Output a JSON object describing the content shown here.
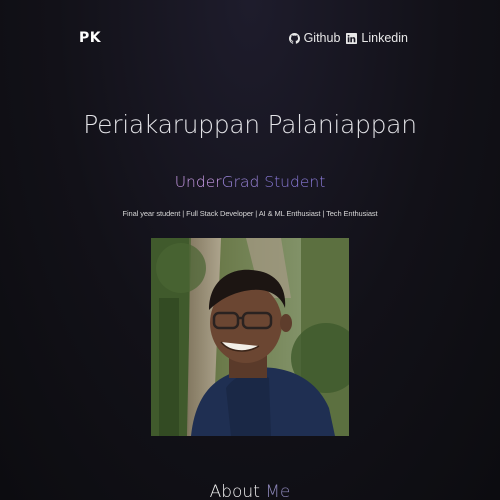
{
  "nav": {
    "logo": "PK",
    "links": [
      {
        "label": "Github",
        "icon": "github-icon"
      },
      {
        "label": "Linkedin",
        "icon": "linkedin-icon"
      }
    ]
  },
  "hero": {
    "name": "Periakaruppan Palaniappan",
    "role_parts": [
      "Under",
      "Grad",
      " Student"
    ],
    "tagline": "Final year student | Full Stack Developer | AI & ML Enthusiast | Tech Enthusiast",
    "photo_label": "profile-photo"
  },
  "about": {
    "heading_first": "About",
    "heading_second": "Me"
  },
  "colors": {
    "background": "#121118",
    "gradient_pink": "#c89ae6",
    "gradient_violet": "#8a7ad8",
    "text": "#e6e6e6"
  }
}
